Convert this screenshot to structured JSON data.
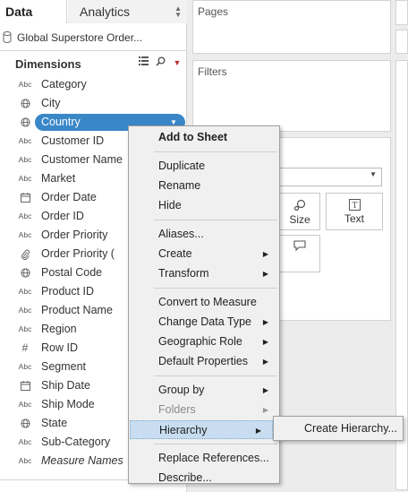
{
  "tabs": {
    "data": "Data",
    "analytics": "Analytics"
  },
  "datasource": {
    "name": "Global Superstore Order..."
  },
  "dimensions": {
    "title": "Dimensions",
    "icons": [
      "list-view-icon",
      "search-icon",
      "menu-caret-icon"
    ],
    "fields": [
      {
        "type": "Abc",
        "label": "Category"
      },
      {
        "type": "globe",
        "label": "City"
      },
      {
        "type": "globe",
        "label": "Country",
        "selected": true
      },
      {
        "type": "Abc",
        "label": "Customer ID"
      },
      {
        "type": "Abc",
        "label": "Customer Name"
      },
      {
        "type": "Abc",
        "label": "Market"
      },
      {
        "type": "calendar",
        "label": "Order Date"
      },
      {
        "type": "Abc",
        "label": "Order ID"
      },
      {
        "type": "Abc",
        "label": "Order Priority"
      },
      {
        "type": "paperclip",
        "label": "Order Priority ("
      },
      {
        "type": "globe",
        "label": "Postal Code"
      },
      {
        "type": "Abc",
        "label": "Product ID"
      },
      {
        "type": "Abc",
        "label": "Product Name"
      },
      {
        "type": "Abc",
        "label": "Region"
      },
      {
        "type": "#",
        "label": "Row ID"
      },
      {
        "type": "Abc",
        "label": "Segment"
      },
      {
        "type": "calendar",
        "label": "Ship Date"
      },
      {
        "type": "Abc",
        "label": "Ship Mode"
      },
      {
        "type": "globe",
        "label": "State"
      },
      {
        "type": "Abc",
        "label": "Sub-Category"
      },
      {
        "type": "Abc",
        "label": "Measure Names",
        "italic": true
      }
    ]
  },
  "shelves": {
    "pages": "Pages",
    "filters": "Filters"
  },
  "marks": {
    "size": "Size",
    "text": "Text"
  },
  "context_menu": {
    "items": [
      {
        "label": "Add to Sheet",
        "bold": true
      },
      {
        "sep": true
      },
      {
        "label": "Duplicate"
      },
      {
        "label": "Rename"
      },
      {
        "label": "Hide"
      },
      {
        "sep": true
      },
      {
        "label": "Aliases..."
      },
      {
        "label": "Create",
        "submenu": true
      },
      {
        "label": "Transform",
        "submenu": true
      },
      {
        "sep": true
      },
      {
        "label": "Convert to Measure"
      },
      {
        "label": "Change Data Type",
        "submenu": true
      },
      {
        "label": "Geographic Role",
        "submenu": true
      },
      {
        "label": "Default Properties",
        "submenu": true
      },
      {
        "sep": true
      },
      {
        "label": "Group by",
        "submenu": true
      },
      {
        "label": "Folders",
        "submenu": true,
        "disabled": true
      },
      {
        "label": "Hierarchy",
        "submenu": true,
        "highlighted": true
      },
      {
        "sep": true
      },
      {
        "label": "Replace References..."
      },
      {
        "label": "Describe..."
      }
    ]
  },
  "submenu": {
    "items": [
      {
        "label": "Create Hierarchy..."
      }
    ]
  },
  "colors": {
    "selection": "#3a87c8",
    "menu_highlight": "#c8def0",
    "menu_bg": "#f0f0f0"
  }
}
